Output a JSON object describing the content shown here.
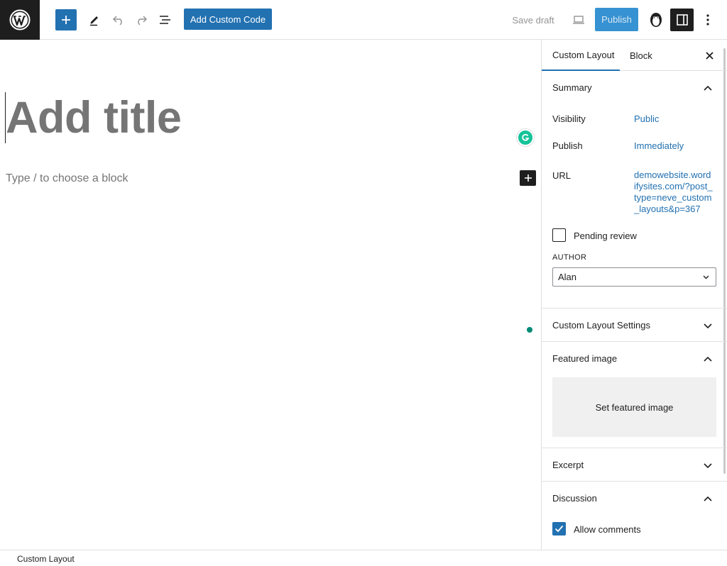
{
  "toolbar": {
    "add_custom_code_label": "Add Custom Code",
    "save_draft_label": "Save draft",
    "publish_label": "Publish"
  },
  "editor": {
    "title_placeholder": "Add title",
    "block_placeholder": "Type / to choose a block"
  },
  "sidebar": {
    "tabs": [
      {
        "label": "Custom Layout",
        "active": true
      },
      {
        "label": "Block",
        "active": false
      }
    ],
    "summary": {
      "title": "Summary",
      "visibility_label": "Visibility",
      "visibility_value": "Public",
      "publish_label": "Publish",
      "publish_value": "Immediately",
      "url_label": "URL",
      "url_value_lines": [
        "demowebsite.word",
        "ifysites.com/?post_",
        "type=neve_custom",
        "_layouts&p=367"
      ],
      "pending_review_label": "Pending review",
      "pending_review_checked": false,
      "author_label": "AUTHOR",
      "author_value": "Alan"
    },
    "custom_layout_settings": {
      "title": "Custom Layout Settings"
    },
    "featured_image": {
      "title": "Featured image",
      "button_label": "Set featured image"
    },
    "excerpt": {
      "title": "Excerpt"
    },
    "discussion": {
      "title": "Discussion",
      "allow_comments_label": "Allow comments",
      "allow_comments_checked": true
    }
  },
  "footer": {
    "breadcrumb": "Custom Layout"
  },
  "colors": {
    "accent": "#2271b1",
    "publish_bg": "#3692d2",
    "dark": "#1e1e1e",
    "grammarly": "#15c39a"
  }
}
